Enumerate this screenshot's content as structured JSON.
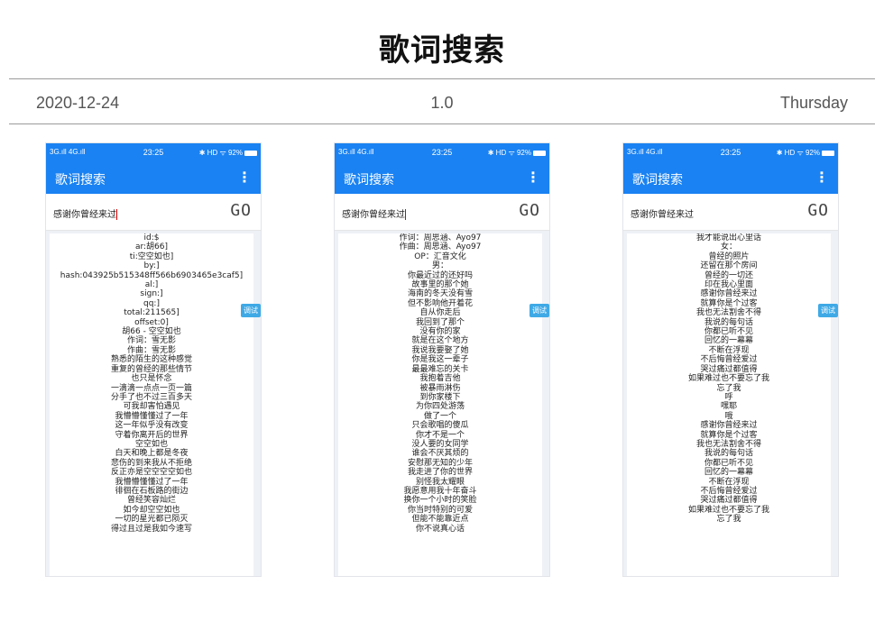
{
  "page": {
    "title": "歌词搜索",
    "date": "2020-12-24",
    "version": "1.0",
    "weekday": "Thursday"
  },
  "colors": {
    "accent": "#1a82f2",
    "debug": "#3fa9e6"
  },
  "screens": [
    {
      "status": {
        "signal": "3G.ıll 4G.ıll",
        "time": "23:25",
        "right": "✱ HD ᯤ 92%"
      },
      "app_title": "歌词搜索",
      "menu_icon": "more-vert-icon",
      "query": "感谢你曾经来过",
      "go": "GO",
      "debug": "调试",
      "lyrics": [
        "id:$",
        "ar:胡66]",
        "ti:空空如也]",
        "by:]",
        "hash:043925b515348ff566b6903465e3caf5]",
        "al:]",
        "sign:]",
        "qq:]",
        "total:211565]",
        "offset:0]",
        "胡66 - 空空如也",
        "作词：雪无影",
        "作曲：雪无影",
        "熟悉的陌生的这种感觉",
        "重复的曾经的那些情节",
        "也只是怀念",
        "一滴滴一点点一页一篇",
        "分手了也不过三百多天",
        "可我却害怕遇见",
        "我懵懵懂懂过了一年",
        "这一年似乎没有改变",
        "守着你离开后的世界",
        "空空如也",
        "白天和晚上都是冬夜",
        "悲伤的到来我从不拒绝",
        "反正亦是空空空空如也",
        "我懵懵懂懂过了一年",
        "徘徊在石板路的街边",
        "曾经笑容灿烂",
        "如今却空空如也",
        "一切的星光都已陨灭",
        "得过且过是我如今速写"
      ]
    },
    {
      "status": {
        "signal": "3G.ıll 4G.ıll",
        "time": "23:25",
        "right": "✱ HD ᯤ 92%"
      },
      "app_title": "歌词搜索",
      "menu_icon": "more-vert-icon",
      "query": "感谢你曾经来过",
      "go": "GO",
      "debug": "调试",
      "lyrics": [
        "作词：周思涵、Ayo97",
        "作曲：周思涵、Ayo97",
        "OP：汇音文化",
        "男：",
        "你最近过的还好吗",
        "故事里的那个她",
        "海南的冬天没有雪",
        "但不影响他开着花",
        "自从你走后",
        "我回到了那个",
        "没有你的家",
        "就是在这个地方",
        "我说我要娶了她",
        "你是我这一辈子",
        "最最难忘的关卡",
        "我抱着吉他",
        "被暴雨淋伤",
        "到你家楼下",
        "为你四处游荡",
        "做了一个",
        "只会歌唱的傻瓜",
        "你才不是一个",
        "没人要的女同学",
        "谁会不厌其烦的",
        "安慰那无知的少年",
        "我走进了你的世界",
        "别怪我太耀眼",
        "我愿意用我十年奋斗",
        "换你一个小时的笑脸",
        "你当时特别的可爱",
        "但能不能靠近点",
        "你不说真心话"
      ]
    },
    {
      "status": {
        "signal": "3G.ıll 4G.ıll",
        "time": "23:25",
        "right": "✱ HD ᯤ 92%"
      },
      "app_title": "歌词搜索",
      "menu_icon": "more-vert-icon",
      "query": "感谢你曾经来过",
      "go": "GO",
      "debug": "调试",
      "lyrics": [
        "我才能说出心里话",
        "女：",
        "曾经的照片",
        "还留在那个房间",
        "曾经的一切还",
        "印在我心里面",
        "感谢你曾经来过",
        "就算你是个过客",
        "我也无法割舍不得",
        "我说的每句话",
        "你都已听不见",
        "回忆的一幕幕",
        "不断在浮现",
        "不后悔曾经爱过",
        "哭过痛过都值得",
        "如果难过也不要忘了我",
        "忘了我",
        "呼",
        "嘿耶",
        "哦",
        "感谢你曾经来过",
        "就算你是个过客",
        "我也无法割舍不得",
        "我说的每句话",
        "你都已听不见",
        "回忆的一幕幕",
        "不断在浮现",
        "不后悔曾经爱过",
        "哭过痛过都值得",
        "如果难过也不要忘了我",
        "忘了我"
      ]
    }
  ]
}
